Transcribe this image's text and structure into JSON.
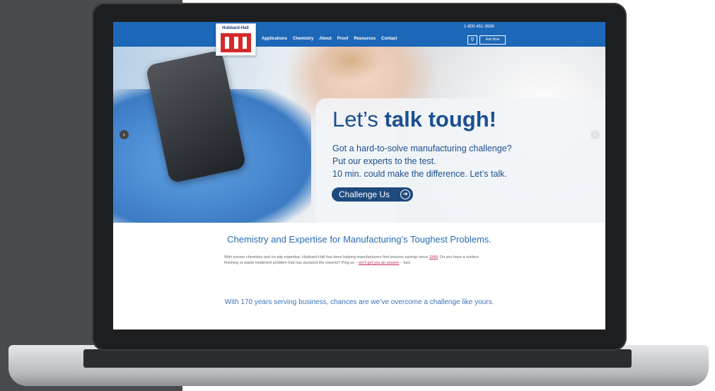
{
  "header": {
    "logo_text": "Hubbard-Hall",
    "phone": "1-800-451-3636",
    "nav": [
      "Applications",
      "Chemistry",
      "About",
      "Proof",
      "Resources",
      "Contact"
    ],
    "cta_label": "Ask Now"
  },
  "hero": {
    "title_prefix": "Let’s ",
    "title_bold": "talk tough!",
    "line1": "Got a hard-to-solve manufacturing challenge?",
    "line2": "Put our experts to the test.",
    "line3": "10 min. could make the difference. Let’s talk.",
    "button_label": "Challenge Us"
  },
  "content": {
    "headline": "Chemistry and Expertise for Manufacturing’s Toughest Problems.",
    "body_before": "With proven chemistry and on-site expertise, Hubbard-Hall has been helping manufacturers find process savings since ",
    "body_link1": "1849",
    "body_middle": ". Do you have a surface finishing or waste treatment problem that has stumped the experts? Ping us – ",
    "body_link2": "we’ll get you an answer",
    "body_after": " – fast.",
    "subhead": "With 170 years serving business, chances are we’ve overcome a challenge like yours."
  }
}
